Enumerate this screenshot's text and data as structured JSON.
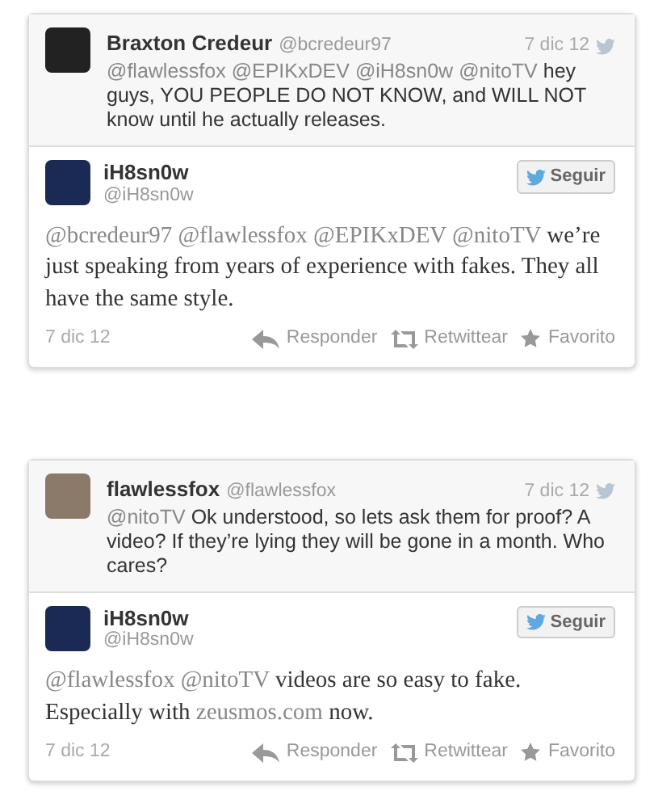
{
  "threads": [
    {
      "parent": {
        "name": "Braxton Credeur",
        "handle": "@bcredeur97",
        "date": "7 dic 12",
        "text": [
          {
            "kind": "mention",
            "text": "@flawlessfox"
          },
          {
            "kind": "mention",
            "text": "@EPIKxDEV"
          },
          {
            "kind": "mention",
            "text": "@iH8sn0w"
          },
          {
            "kind": "mention",
            "text": "@nitoTV"
          },
          {
            "kind": "plain",
            "text": "hey guys, YOU PEOPLE DO NOT KNOW, and WILL NOT know until he actually releases."
          }
        ]
      },
      "tweet": {
        "name": "iH8sn0w",
        "handle": "@iH8sn0w",
        "follow": "Seguir",
        "text": [
          {
            "kind": "mention",
            "text": "@bcredeur97"
          },
          {
            "kind": "mention",
            "text": "@flawlessfox"
          },
          {
            "kind": "mention",
            "text": "@EPIKxDEV"
          },
          {
            "kind": "mention",
            "text": "@nitoTV"
          },
          {
            "kind": "plain",
            "text": "we’re just speaking from years of experience with fakes. They all have the same style."
          }
        ],
        "date": "7 dic 12",
        "actions": [
          {
            "kind": "reply",
            "label": "Responder"
          },
          {
            "kind": "retweet",
            "label": "Retwittear"
          },
          {
            "kind": "favorite",
            "label": "Favorito"
          }
        ]
      }
    },
    {
      "parent": {
        "name": "flawlessfox",
        "handle": "@flawlessfox",
        "date": "7 dic 12",
        "text": [
          {
            "kind": "mention",
            "text": "@nitoTV"
          },
          {
            "kind": "plain",
            "text": "Ok understood, so lets ask them for proof? A video? If they’re lying they will be gone in a month. Who cares?"
          }
        ]
      },
      "tweet": {
        "name": "iH8sn0w",
        "handle": "@iH8sn0w",
        "follow": "Seguir",
        "text": [
          {
            "kind": "mention",
            "text": "@flawlessfox"
          },
          {
            "kind": "mention",
            "text": "@nitoTV"
          },
          {
            "kind": "plain",
            "text": "videos are so easy to fake. Especially with"
          },
          {
            "kind": "link",
            "text": "zeusmos.com"
          },
          {
            "kind": "plain",
            "text": "now."
          }
        ],
        "date": "7 dic 12",
        "actions": [
          {
            "kind": "reply",
            "label": "Responder"
          },
          {
            "kind": "retweet",
            "label": "Retwittear"
          },
          {
            "kind": "favorite",
            "label": "Favorito"
          }
        ]
      }
    }
  ]
}
